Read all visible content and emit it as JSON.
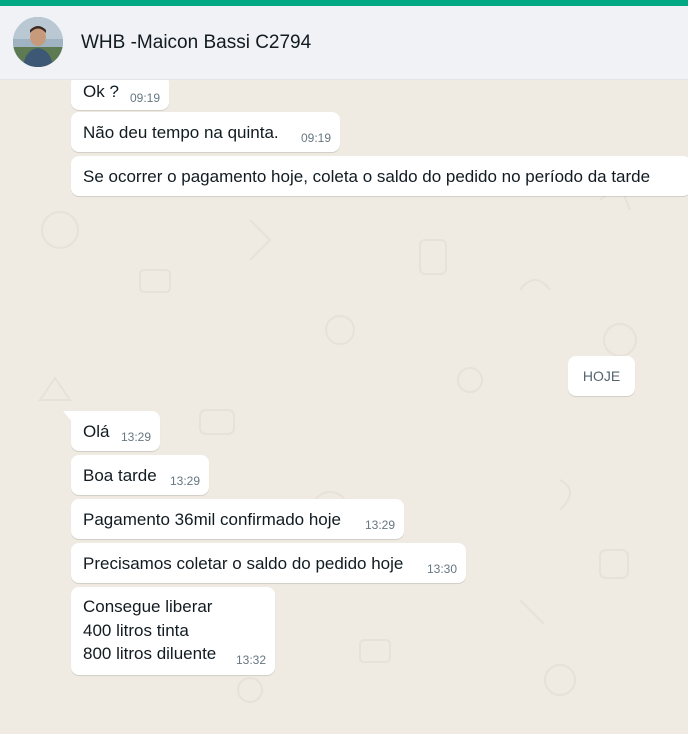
{
  "contact": {
    "name": "WHB -Maicon Bassi C2794"
  },
  "day_separator": "HOJE",
  "messages_earlier": [
    {
      "text": "Ok ?",
      "time": "09:19"
    },
    {
      "text": "Não deu tempo na quinta.",
      "time": "09:19"
    },
    {
      "text": "Se ocorrer o pagamento hoje, coleta o saldo do pedido no período da tarde",
      "time": ""
    }
  ],
  "messages_today": [
    {
      "text": "Olá",
      "time": "13:29"
    },
    {
      "text": "Boa tarde",
      "time": "13:29"
    },
    {
      "text": "Pagamento 36mil confirmado hoje",
      "time": "13:29"
    },
    {
      "text": "Precisamos coletar o saldo do pedido hoje",
      "time": "13:30"
    },
    {
      "text": "Consegue liberar\n400 litros tinta\n800 litros diluente",
      "time": "13:32"
    }
  ],
  "colors": {
    "accent": "#00a884",
    "chat_background": "#efeae2",
    "bubble": "#ffffff",
    "header": "#f0f2f5"
  },
  "icons": {
    "wallpaper": "doodle-pattern"
  }
}
